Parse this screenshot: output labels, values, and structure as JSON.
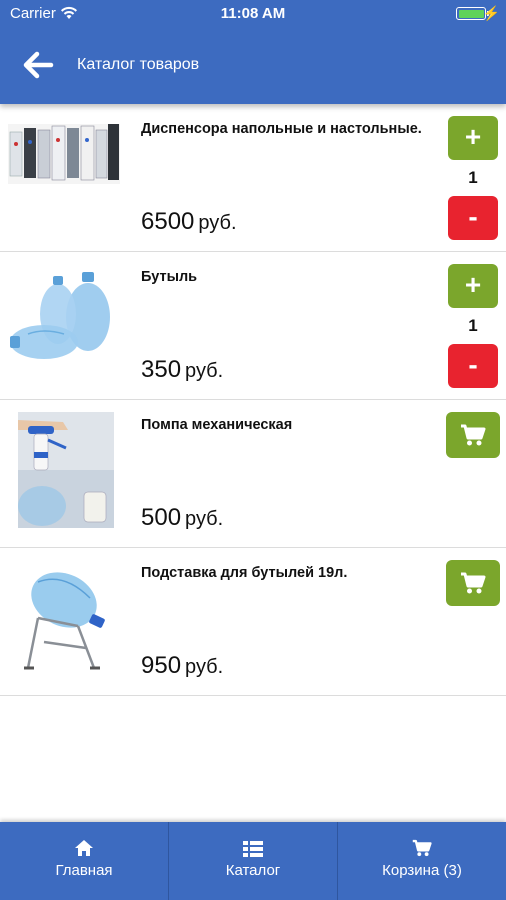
{
  "status_bar": {
    "carrier": "Carrier",
    "time": "11:08 AM"
  },
  "header": {
    "title": "Каталог товаров",
    "back_icon": "arrow-left-icon"
  },
  "products": [
    {
      "name": "Диспенсора напольные и настольные.",
      "price": "6500",
      "currency": "руб.",
      "quantity": "1",
      "plus_label": "+",
      "minus_label": "-",
      "image_icon": "water-dispensers-image"
    },
    {
      "name": "Бутыль",
      "price": "350",
      "currency": "руб.",
      "quantity": "1",
      "plus_label": "+",
      "minus_label": "-",
      "image_icon": "water-bottles-image"
    },
    {
      "name": "Помпа механическая",
      "price": "500",
      "currency": "руб.",
      "image_icon": "water-pump-image",
      "cart_icon": "cart-icon"
    },
    {
      "name": "Подставка для бутылей 19л.",
      "price": "950",
      "currency": "руб.",
      "image_icon": "bottle-stand-image",
      "cart_icon": "cart-icon"
    }
  ],
  "tabs": [
    {
      "label": "Главная",
      "icon": "home-icon"
    },
    {
      "label": "Каталог",
      "icon": "list-icon"
    },
    {
      "label": "Корзина (3)",
      "icon": "cart-icon"
    }
  ],
  "colors": {
    "primary": "#3d6bc0",
    "add_green": "#7ba62c",
    "remove_red": "#e8232f",
    "battery_green": "#5fd35a"
  }
}
